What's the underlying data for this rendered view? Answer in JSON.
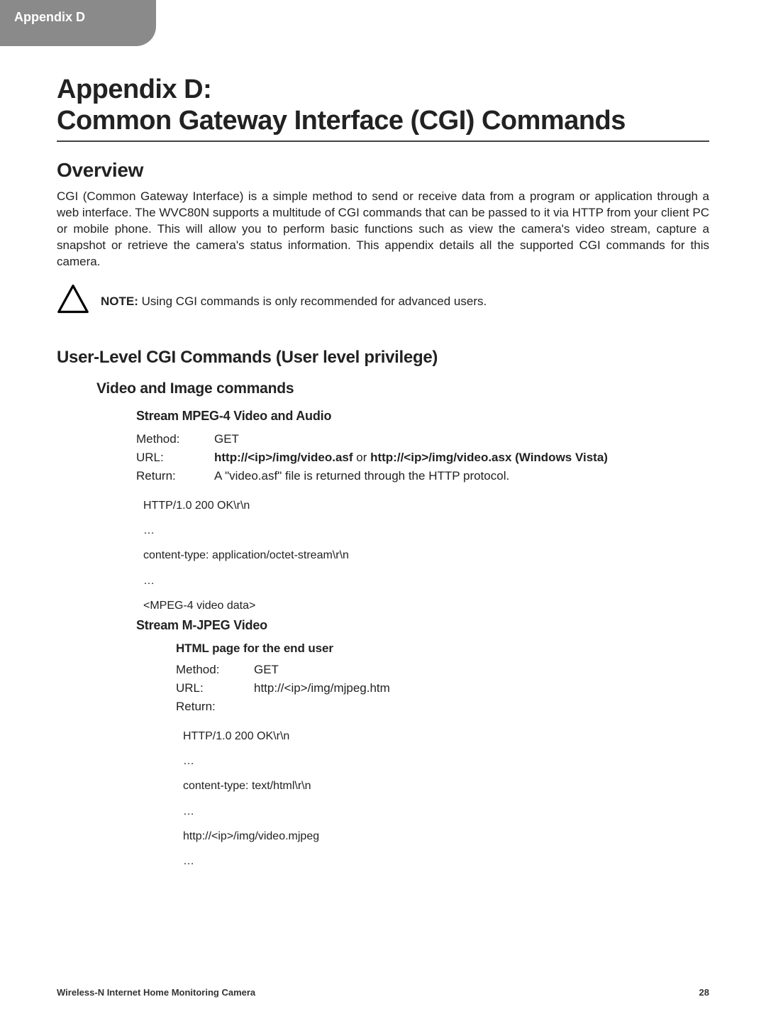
{
  "tab": "Appendix D",
  "title_line1": "Appendix D:",
  "title_line2": "Common Gateway Interface (CGI) Commands",
  "overview_heading": "Overview",
  "overview_body": "CGI (Common Gateway Interface) is a simple method to send or receive data from a program or application through a web interface.  The WVC80N supports a multitude of CGI commands that can be passed to it via HTTP from your client PC or mobile phone. This will allow you to perform basic functions such as view the camera's video stream, capture a snapshot or retrieve the camera's status information.  This appendix details all the supported CGI commands for this camera.",
  "note_label": "NOTE:",
  "note_text": " Using CGI commands is only recommended for advanced users.",
  "section_user_level": "User-Level CGI Commands (User level privilege)",
  "section_video_image": "Video and Image commands",
  "cmd1": {
    "title": "Stream MPEG-4 Video and Audio",
    "method_label": "Method:",
    "method_value": "GET",
    "url_label": "URL:",
    "url_bold1": "http://<ip>/img/video.asf",
    "url_mid": " or ",
    "url_bold2": "http://<ip>/img/video.asx (Windows Vista)",
    "return_label": "Return:",
    "return_value": "A \"video.asf\" file is returned through the HTTP protocol.",
    "ret_lines": [
      "HTTP/1.0 200 OK\\r\\n",
      "…",
      "content-type: application/octet-stream\\r\\n",
      "…",
      "<MPEG-4 video data>"
    ]
  },
  "cmd2": {
    "title": "Stream M-JPEG Video",
    "sub_title": "HTML page for the end user",
    "method_label": "Method:",
    "method_value": "GET",
    "url_label": "URL:",
    "url_bold": "http://<ip>/img/mjpeg.htm",
    "return_label": "Return:",
    "ret_lines": [
      "HTTP/1.0 200 OK\\r\\n",
      "…",
      "content-type: text/html\\r\\n",
      "…",
      "http://<ip>/img/video.mjpeg",
      "…"
    ]
  },
  "footer_left": "Wireless-N Internet Home Monitoring Camera",
  "footer_right": "28"
}
